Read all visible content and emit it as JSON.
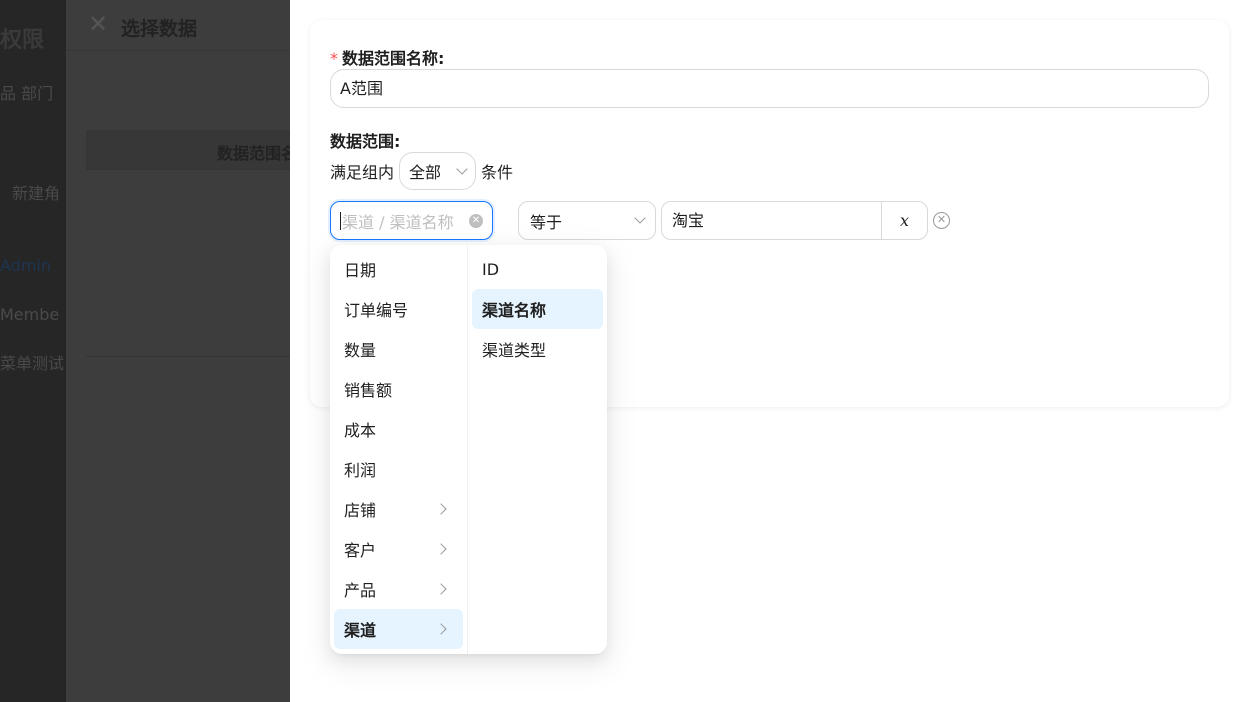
{
  "background_page": {
    "title": "权限",
    "tabs_text": "品  部门",
    "new_button": "新建角",
    "rows": [
      "Admin",
      "Membe",
      "菜单测试"
    ]
  },
  "drawer1": {
    "title": "选择数据",
    "column_header": "数据范围名"
  },
  "form": {
    "name_label": "数据范围名称:",
    "required_mark": "*",
    "name_value": "A范围",
    "range_label": "数据范围:",
    "cond_prefix": "满足组内",
    "cond_value": "全部",
    "cond_suffix": "条件",
    "field_placeholder": "渠道 / 渠道名称",
    "operator": "等于",
    "value": "淘宝",
    "value_mode": "x"
  },
  "cascader": {
    "level1": [
      {
        "label": "日期",
        "has_children": false
      },
      {
        "label": "订单编号",
        "has_children": false
      },
      {
        "label": "数量",
        "has_children": false
      },
      {
        "label": "销售额",
        "has_children": false
      },
      {
        "label": "成本",
        "has_children": false
      },
      {
        "label": "利润",
        "has_children": false
      },
      {
        "label": "店铺",
        "has_children": true
      },
      {
        "label": "客户",
        "has_children": true
      },
      {
        "label": "产品",
        "has_children": true
      },
      {
        "label": "渠道",
        "has_children": true,
        "active": true
      }
    ],
    "level2": [
      {
        "label": "ID"
      },
      {
        "label": "渠道名称",
        "active": true
      },
      {
        "label": "渠道类型"
      }
    ]
  },
  "colors": {
    "accent": "#1677ff",
    "active_bg": "#e6f4ff",
    "required": "#ff4d4f"
  }
}
